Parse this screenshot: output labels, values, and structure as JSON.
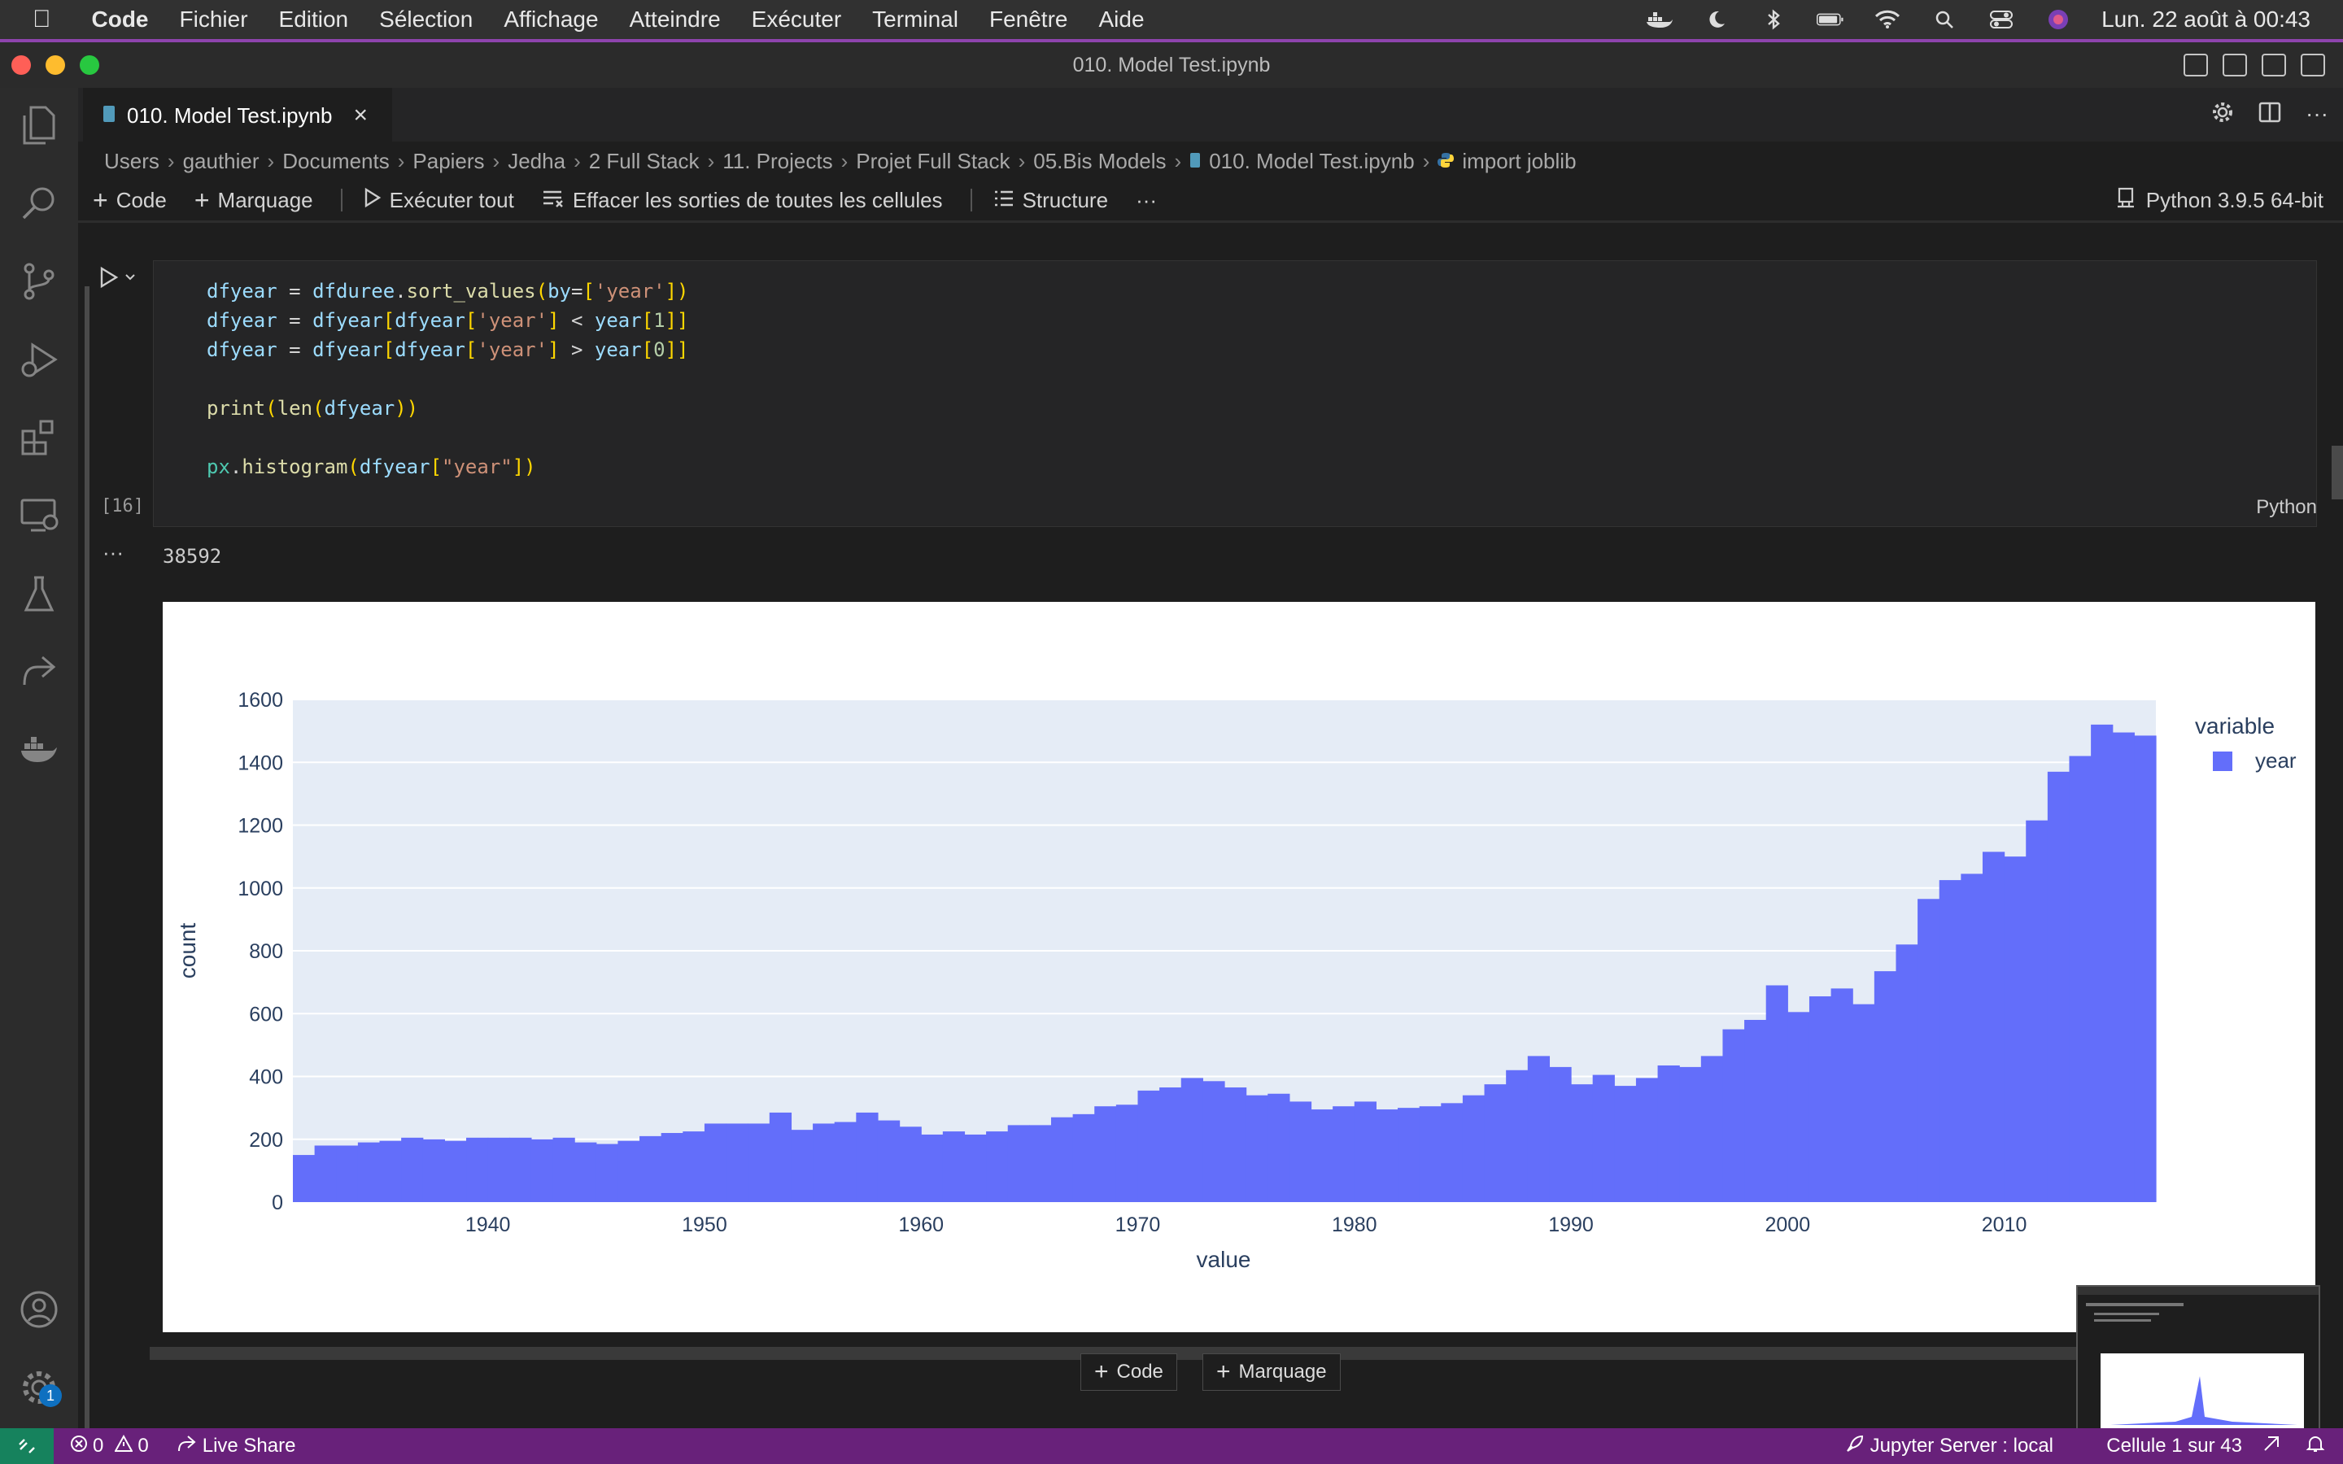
{
  "menubar": {
    "app": "Code",
    "items": [
      "Fichier",
      "Edition",
      "Sélection",
      "Affichage",
      "Atteindre",
      "Exécuter",
      "Terminal",
      "Fenêtre",
      "Aide"
    ],
    "clock": "Lun. 22 août à 00:43"
  },
  "window": {
    "title": "010. Model Test.ipynb"
  },
  "tab": {
    "label": "010. Model Test.ipynb",
    "close": "×"
  },
  "breadcrumb": [
    "Users",
    "gauthier",
    "Documents",
    "Papiers",
    "Jedha",
    "2 Full Stack",
    "11. Projects",
    "Projet Full Stack",
    "05.Bis Models",
    "010. Model Test.ipynb",
    "import joblib"
  ],
  "toolbar": {
    "code": "Code",
    "markdown": "Marquage",
    "run_all": "Exécuter tout",
    "clear_outputs": "Effacer les sorties de toutes les cellules",
    "outline": "Structure",
    "more": "···",
    "kernel": "Python 3.9.5 64-bit"
  },
  "cell": {
    "exec_count": "[16]",
    "language": "Python",
    "output_text": "38592",
    "output_menu": "···"
  },
  "add_cell": {
    "code": "Code",
    "markdown": "Marquage"
  },
  "statusbar": {
    "errors": "0",
    "warnings": "0",
    "live_share": "Live Share",
    "jupyter": "Jupyter Server : local",
    "cell_pos": "Cellule 1 sur 43"
  },
  "activity_badge": "1",
  "colors": {
    "bar": "#636efa",
    "plot_bg": "#e5ecf6",
    "status": "#68217a",
    "accent": "#8e44ad"
  },
  "chart_data": {
    "type": "bar",
    "xlabel": "value",
    "ylabel": "count",
    "legend_title": "variable",
    "legend_placement": "top-right",
    "x_start": 1931,
    "bin_width": 1,
    "ylim": [
      0,
      1600
    ],
    "xlim": [
      1931,
      2017
    ],
    "x_ticks": [
      "1940",
      "1950",
      "1960",
      "1970",
      "1980",
      "1990",
      "2000",
      "2010"
    ],
    "y_ticks": [
      "0",
      "200",
      "400",
      "600",
      "800",
      "1000",
      "1200",
      "1400",
      "1600"
    ],
    "series": [
      {
        "name": "year",
        "color": "#636efa",
        "values": [
          150,
          180,
          180,
          190,
          195,
          205,
          200,
          195,
          205,
          205,
          205,
          200,
          205,
          190,
          185,
          195,
          210,
          220,
          225,
          250,
          250,
          250,
          285,
          230,
          250,
          255,
          285,
          260,
          240,
          215,
          225,
          215,
          225,
          245,
          245,
          270,
          280,
          305,
          310,
          355,
          365,
          395,
          385,
          365,
          340,
          345,
          320,
          295,
          305,
          320,
          295,
          300,
          305,
          315,
          340,
          375,
          420,
          465,
          430,
          375,
          405,
          370,
          395,
          435,
          430,
          465,
          550,
          580,
          690,
          605,
          655,
          680,
          630,
          735,
          820,
          965,
          1025,
          1045,
          1115,
          1100,
          1215,
          1370,
          1420,
          1520,
          1495,
          1485
        ]
      }
    ]
  }
}
